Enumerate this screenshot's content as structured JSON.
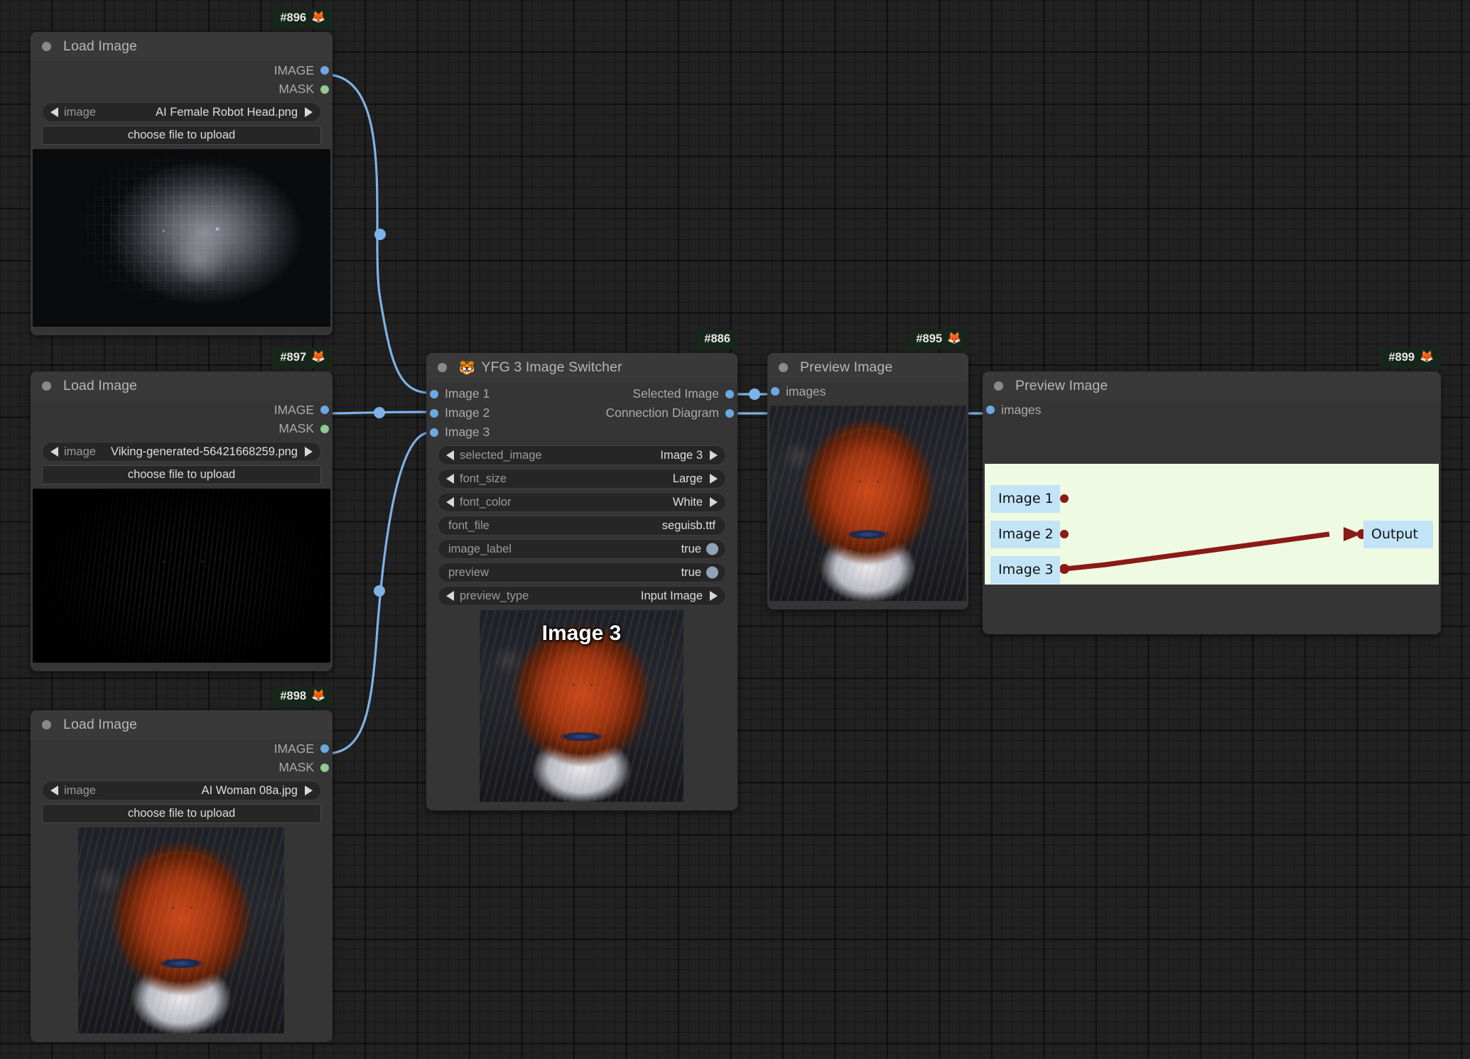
{
  "canvas": {
    "background": "#212121",
    "grid": true
  },
  "link_color": "#7db3e6",
  "nodes": [
    {
      "id": "#896",
      "badge_emoji": "🦊",
      "title": "Load Image",
      "outputs": [
        {
          "label": "IMAGE",
          "color": "#6ca8e0"
        },
        {
          "label": "MASK",
          "color": "#92c98e"
        }
      ],
      "widgets": [
        {
          "type": "combo",
          "name": "image",
          "value": "AI Female Robot Head.png"
        },
        {
          "type": "button",
          "label": "choose file to upload"
        }
      ],
      "preview_alt": "AI Female Robot Head"
    },
    {
      "id": "#897",
      "badge_emoji": "🦊",
      "title": "Load Image",
      "outputs": [
        {
          "label": "IMAGE",
          "color": "#6ca8e0"
        },
        {
          "label": "MASK",
          "color": "#92c98e"
        }
      ],
      "widgets": [
        {
          "type": "combo",
          "name": "image",
          "value": "Viking-generated-56421668259.png"
        },
        {
          "type": "button",
          "label": "choose file to upload"
        }
      ],
      "preview_alt": "Viking generated"
    },
    {
      "id": "#898",
      "badge_emoji": "🦊",
      "title": "Load Image",
      "outputs": [
        {
          "label": "IMAGE",
          "color": "#6ca8e0"
        },
        {
          "label": "MASK",
          "color": "#92c98e"
        }
      ],
      "widgets": [
        {
          "type": "combo",
          "name": "image",
          "value": "AI Woman 08a.jpg"
        },
        {
          "type": "button",
          "label": "choose file to upload"
        }
      ],
      "preview_alt": "AI Woman 08a"
    },
    {
      "id": "#886",
      "badge_emoji": "",
      "title": "YFG 3 Image Switcher",
      "title_emoji": "🐯",
      "inputs": [
        {
          "label": "Image 1",
          "color": "#6ca8e0"
        },
        {
          "label": "Image 2",
          "color": "#6ca8e0"
        },
        {
          "label": "Image 3",
          "color": "#6ca8e0"
        }
      ],
      "outputs": [
        {
          "label": "Selected Image",
          "color": "#6ca8e0"
        },
        {
          "label": "Connection Diagram",
          "color": "#6ca8e0"
        }
      ],
      "widgets": [
        {
          "type": "combo",
          "name": "selected_image",
          "value": "Image 3"
        },
        {
          "type": "combo",
          "name": "font_size",
          "value": "Large"
        },
        {
          "type": "combo",
          "name": "font_color",
          "value": "White"
        },
        {
          "type": "text",
          "name": "font_file",
          "value": "seguisb.ttf"
        },
        {
          "type": "toggle",
          "name": "image_label",
          "value": "true"
        },
        {
          "type": "toggle",
          "name": "preview",
          "value": "true"
        },
        {
          "type": "combo",
          "name": "preview_type",
          "value": "Input Image"
        }
      ],
      "preview_label": "Image 3"
    },
    {
      "id": "#895",
      "badge_emoji": "🦊",
      "title": "Preview Image",
      "inputs": [
        {
          "label": "images",
          "color": "#6ca8e0"
        }
      ]
    },
    {
      "id": "#899",
      "badge_emoji": "🦊",
      "title": "Preview Image",
      "inputs": [
        {
          "label": "images",
          "color": "#6ca8e0"
        }
      ]
    }
  ],
  "connection_diagram": {
    "background": "#eefbe2",
    "box_color": "#c3e4f7",
    "line_color": "#8b1a16",
    "inputs": [
      "Image 1",
      "Image 2",
      "Image 3"
    ],
    "output": "Output",
    "active_link": {
      "from": "Image 3",
      "to": "Output"
    }
  }
}
